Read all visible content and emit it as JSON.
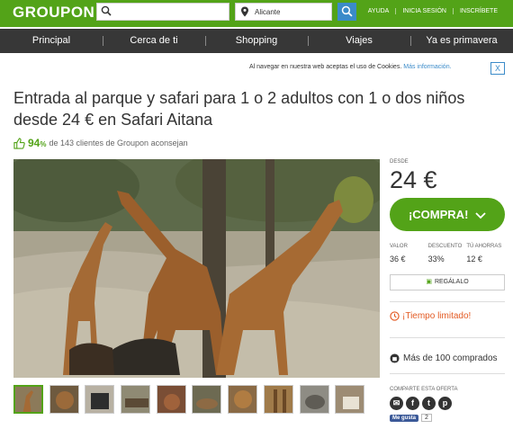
{
  "header": {
    "logo": "GROUPON",
    "location_value": "Alicante",
    "links": [
      "AYUDA",
      "INICIA SESIÓN",
      "INSCRÍBETE"
    ]
  },
  "nav": [
    "Principal",
    "Cerca de ti",
    "Shopping",
    "Viajes",
    "Ya es primavera"
  ],
  "cookie": {
    "message": "Al navegar en nuestra web aceptas el uso de Cookies.",
    "link": "Más información.",
    "close": "X"
  },
  "deal": {
    "title": "Entrada al parque y safari para 1 o 2 adultos con 1 o dos niños desde 24 € en Safari Aitana",
    "rating_pct": "94",
    "rating_unit": "%",
    "rating_text": "de 143 clientes de Groupon aconsejan"
  },
  "sidebar": {
    "desde": "DESDE",
    "price": "24 €",
    "buy": "¡COMPRA!",
    "stats": [
      {
        "label": "VALOR",
        "value": "36 €"
      },
      {
        "label": "DESCUENTO",
        "value": "33%"
      },
      {
        "label": "TÚ AHORRAS",
        "value": "12 €"
      }
    ],
    "gift": "REGÁLALO",
    "limited": "¡Tiempo limitado!",
    "bought": "Más de 100 comprados",
    "share": "COMPARTE ESTA OFERTA",
    "like": "Me gusta",
    "like_count": "2"
  },
  "colors": {
    "brand": "#53a318",
    "nav": "#373737",
    "link": "#3b8bc9",
    "alert": "#e35b24"
  }
}
